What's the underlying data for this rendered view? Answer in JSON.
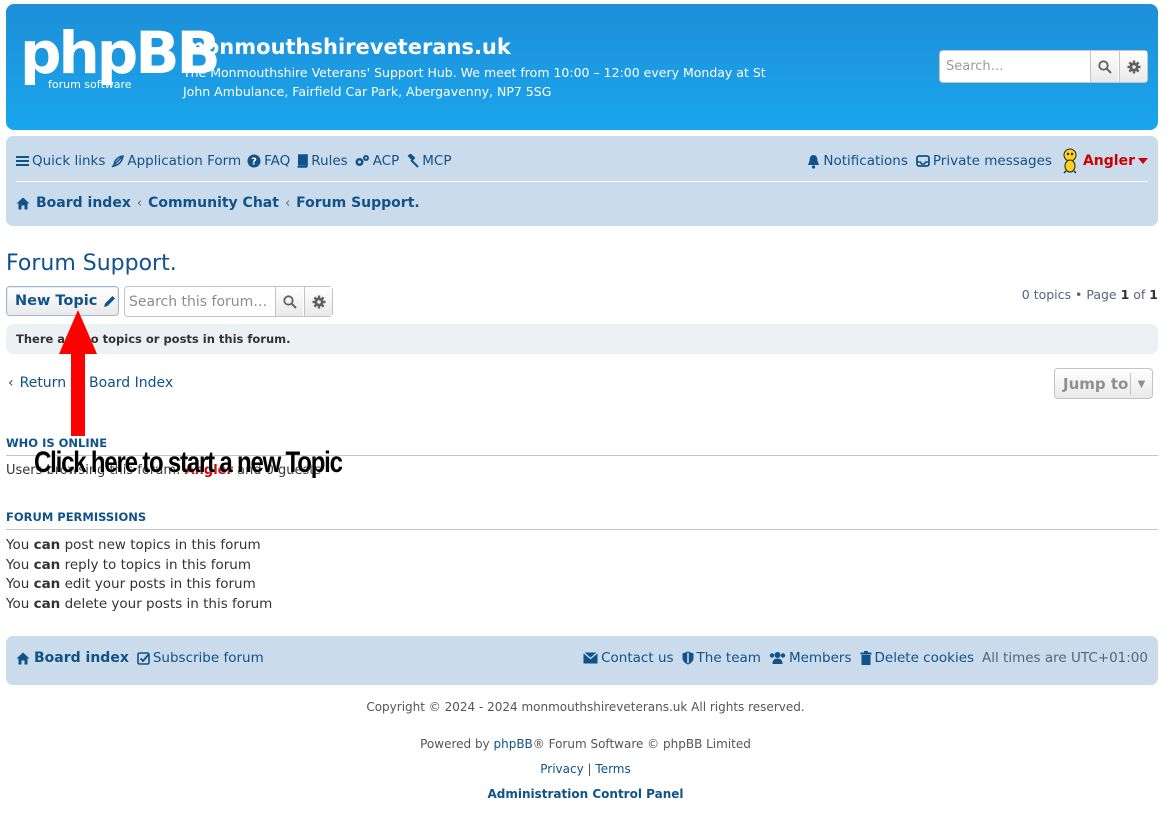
{
  "header": {
    "logo_main": "phpBB",
    "logo_sub": "forum  software",
    "site_title": "monmouthshireveterans.uk",
    "site_desc": "The Monmouthshire Veterans' Support Hub. We meet from 10:00 – 12:00 every Monday at St John Ambulance, Fairfield Car Park, Abergavenny, NP7 5SG",
    "search_placeholder": "Search…"
  },
  "nav": {
    "quick_links": "Quick links",
    "application_form": "Application Form",
    "faq": "FAQ",
    "rules": "Rules",
    "acp": "ACP",
    "mcp": "MCP",
    "notifications": "Notifications",
    "private_messages": "Private messages",
    "username": "Angler"
  },
  "breadcrumbs": [
    "Board index",
    "Community Chat",
    "Forum Support."
  ],
  "forum": {
    "title": "Forum Support.",
    "new_topic": "New Topic",
    "search_placeholder": "Search this forum…",
    "pagination_prefix": "0 topics • Page ",
    "page_current": "1",
    "pagination_of": " of ",
    "page_total": "1",
    "empty_notice": "There are no topics or posts in this forum.",
    "return_link": "Return to Board Index",
    "jump_to": "Jump to"
  },
  "who_is_online": {
    "heading": "Who is online",
    "text_prefix": "Users browsing this forum: ",
    "user": "Angler",
    "text_suffix": " and 0 guests"
  },
  "permissions": {
    "heading": "Forum permissions",
    "lines": [
      {
        "pre": "You ",
        "can": "can",
        "post": " post new topics in this forum"
      },
      {
        "pre": "You ",
        "can": "can",
        "post": " reply to topics in this forum"
      },
      {
        "pre": "You ",
        "can": "can",
        "post": " edit your posts in this forum"
      },
      {
        "pre": "You ",
        "can": "can",
        "post": " delete your posts in this forum"
      }
    ]
  },
  "annotation": {
    "text": "Click here to start a new Topic",
    "color": "#ff0000"
  },
  "footer": {
    "board_index": "Board index",
    "subscribe": "Subscribe forum",
    "contact": "Contact us",
    "team": "The team",
    "members": "Members",
    "delete_cookies": "Delete cookies",
    "times": "All times are UTC+01:00"
  },
  "copyright": {
    "line1": "Copyright © 2024 - 2024 monmouthshireveterans.uk All rights reserved.",
    "powered_pre": "Powered by ",
    "powered_link": "phpBB",
    "powered_post": "® Forum Software © phpBB Limited",
    "privacy": "Privacy",
    "divider": "|",
    "terms": "Terms",
    "acp": "Administration Control Panel"
  },
  "colors": {
    "header_bg": "#1a9be3",
    "nav_bg": "#cadceb",
    "link": "#105289",
    "username": "#cc0000"
  }
}
